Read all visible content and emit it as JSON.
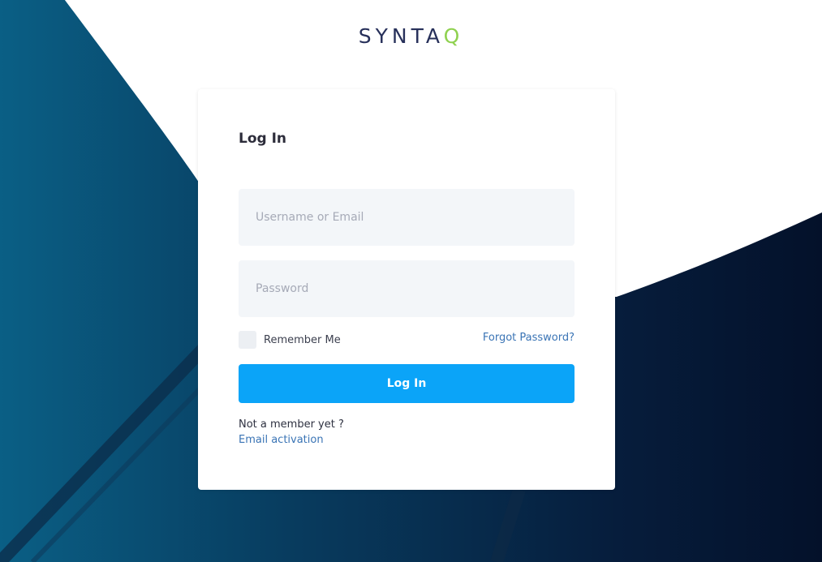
{
  "brand": {
    "logo_text": "SYNTA",
    "logo_accent": "Q",
    "logo_color": "#27305a",
    "accent_color": "#8fd14f"
  },
  "login_form": {
    "title": "Log In",
    "username_placeholder": "Username or Email",
    "password_placeholder": "Password",
    "remember_label": "Remember Me",
    "forgot_label": "Forgot Password?",
    "submit_label": "Log In",
    "signup_prompt": "Not a member yet ?",
    "activation_link": "Email activation"
  },
  "colors": {
    "primary_button": "#0ba4f8",
    "link": "#3a74b5",
    "background_dark": "#0a1a33"
  }
}
